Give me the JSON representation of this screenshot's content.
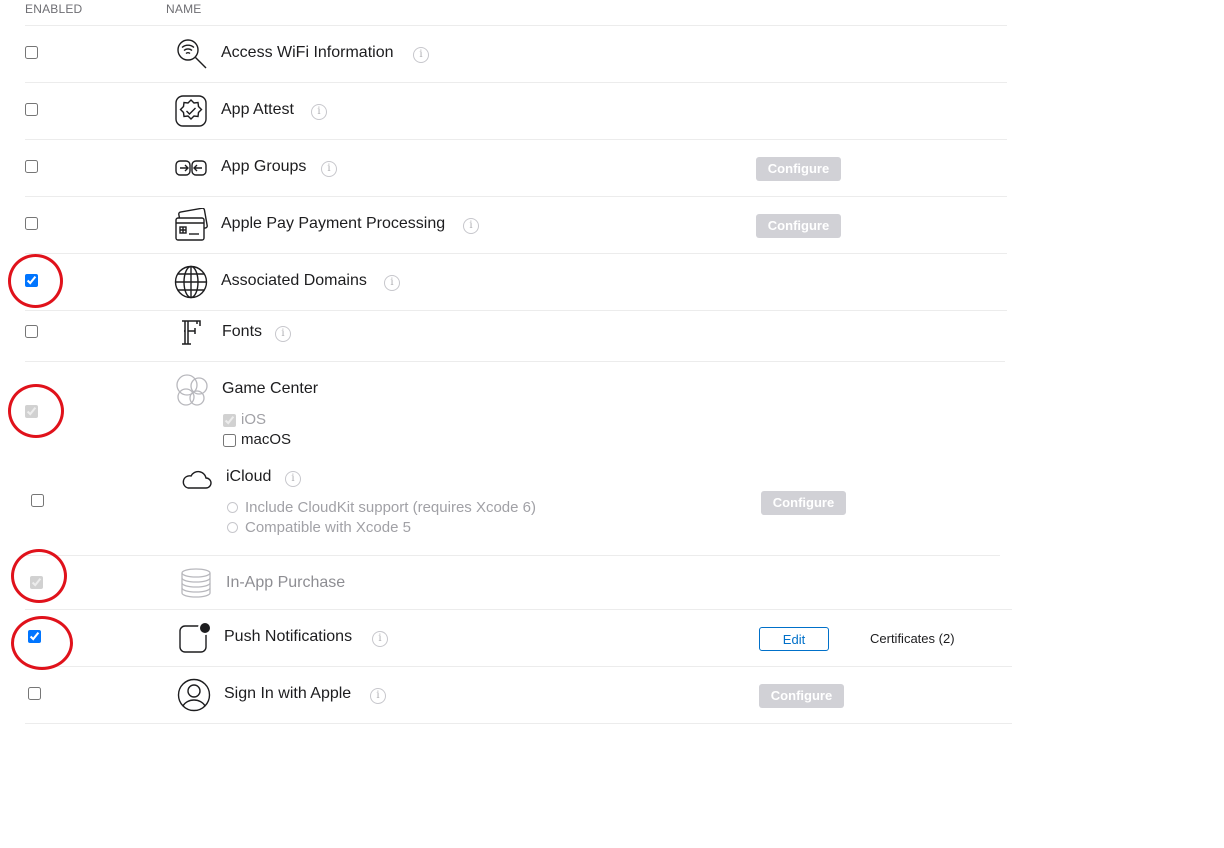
{
  "headers": {
    "enabled": "ENABLED",
    "name": "NAME"
  },
  "rows": [
    {
      "name": "Access WiFi Information",
      "enabled": false,
      "icon": "wifi-search-icon"
    },
    {
      "name": "App Attest",
      "enabled": false,
      "icon": "badge-check-icon"
    },
    {
      "name": "App Groups",
      "enabled": false,
      "icon": "app-groups-icon",
      "button": "Configure"
    },
    {
      "name": "Apple Pay Payment Processing",
      "enabled": false,
      "icon": "credit-card-icon",
      "button": "Configure"
    },
    {
      "name": "Associated Domains",
      "enabled": true,
      "icon": "globe-icon"
    },
    {
      "name": "Fonts",
      "enabled": false,
      "icon": "font-icon"
    },
    {
      "name": "Game Center",
      "enabled": true,
      "disabled": true,
      "icon": "game-center-icon",
      "options": [
        {
          "label": "iOS",
          "checked": true,
          "disabled": true
        },
        {
          "label": "macOS",
          "checked": false
        }
      ]
    },
    {
      "name": "iCloud",
      "enabled": false,
      "icon": "cloud-icon",
      "button": "Configure",
      "options": [
        "Include CloudKit support (requires Xcode 6)",
        "Compatible with Xcode 5"
      ]
    },
    {
      "name": "In-App Purchase",
      "enabled": true,
      "disabled": true,
      "icon": "coins-icon"
    },
    {
      "name": "Push Notifications",
      "enabled": true,
      "icon": "notification-icon",
      "button": "Edit",
      "extra": "Certificates (2)"
    },
    {
      "name": "Sign In with Apple",
      "enabled": false,
      "icon": "person-icon",
      "button": "Configure"
    }
  ],
  "info_glyph": "i",
  "colors": {
    "accent": "#0070c9",
    "annotation_ring": "#e0121b",
    "configure_bg": "#d1d1d6"
  }
}
